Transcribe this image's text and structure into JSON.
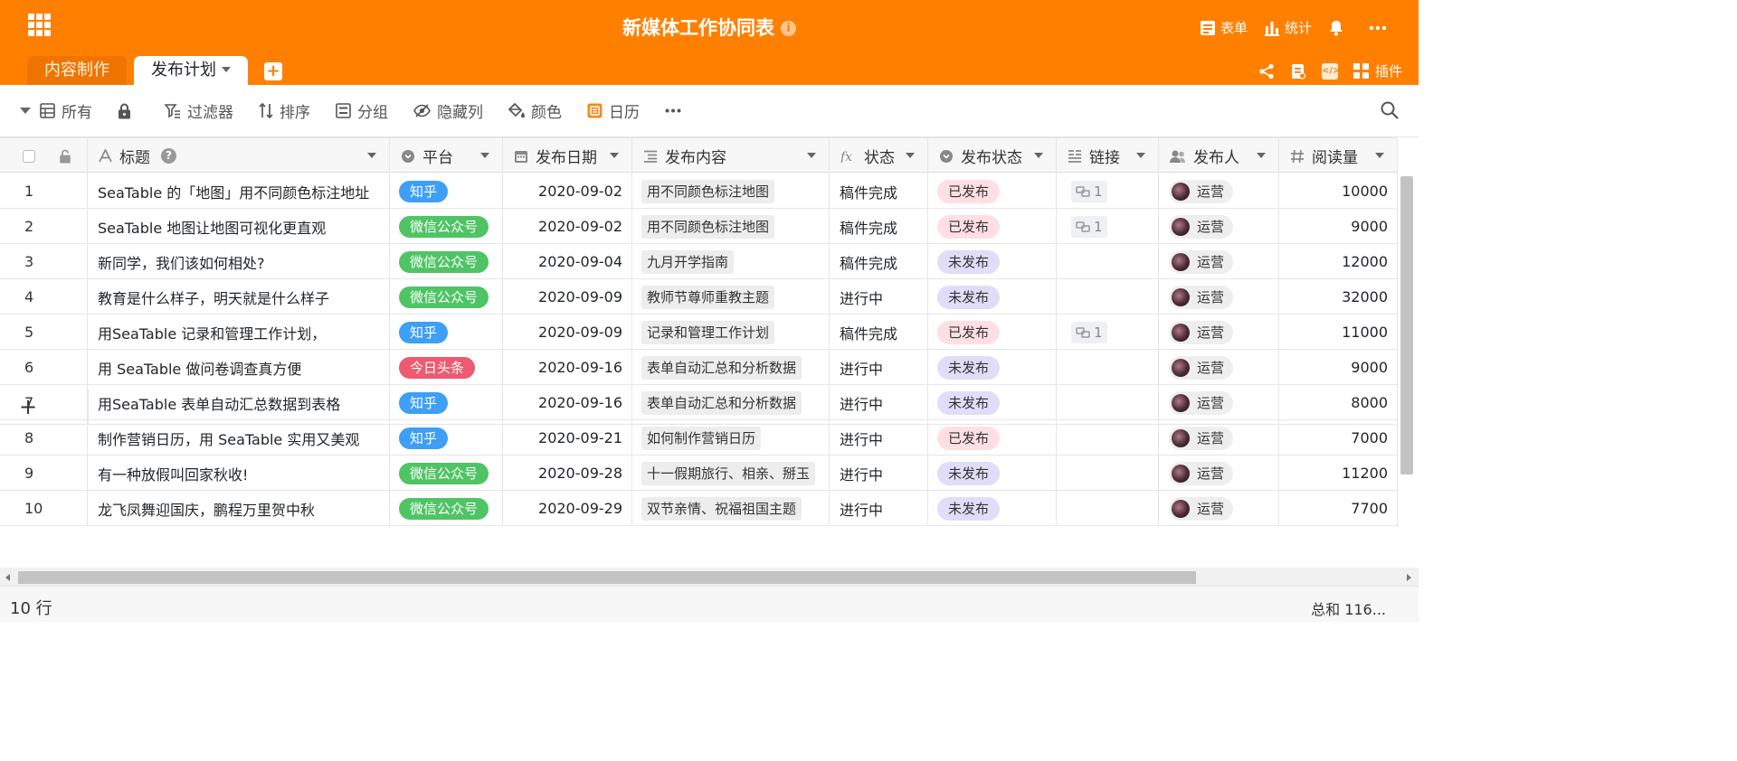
{
  "app": {
    "title": "新媒体工作协同表",
    "header_buttons": [
      {
        "label": "表单",
        "icon": "form-icon"
      },
      {
        "label": "统计",
        "icon": "bar-chart-icon"
      }
    ],
    "plugins_label": "插件"
  },
  "tabs": [
    {
      "label": "内容制作",
      "active": false
    },
    {
      "label": "发布计划",
      "active": true
    }
  ],
  "toolbar": {
    "view": "所有",
    "filter": "过滤器",
    "sort": "排序",
    "group": "分组",
    "hide": "隐藏列",
    "color": "颜色",
    "calendar": "日历"
  },
  "columns": {
    "title": "标题",
    "platform": "平台",
    "date": "发布日期",
    "content": "发布内容",
    "status": "状态",
    "pub_status": "发布状态",
    "link": "链接",
    "publisher": "发布人",
    "reads": "阅读量"
  },
  "colors": {
    "brand": "#ff8000",
    "知乎": "#3d9ff5",
    "微信公众号": "#4fc465",
    "今日头条": "#ee5a70",
    "已发布": "#ffdfe3",
    "未发布": "#e1dcf8"
  },
  "rows": [
    {
      "n": "1",
      "title": "SeaTable 的「地图」用不同颜色标注地址",
      "platform": "知乎",
      "date": "2020-09-02",
      "content": "用不同颜色标注地图",
      "status": "稿件完成",
      "pub": "已发布",
      "link": "1",
      "user": "运营",
      "reads": "10000"
    },
    {
      "n": "2",
      "title": "SeaTable 地图让地图可视化更直观",
      "platform": "微信公众号",
      "date": "2020-09-02",
      "content": "用不同颜色标注地图",
      "status": "稿件完成",
      "pub": "已发布",
      "link": "1",
      "user": "运营",
      "reads": "9000"
    },
    {
      "n": "3",
      "title": "新同学，我们该如何相处?",
      "platform": "微信公众号",
      "date": "2020-09-04",
      "content": "九月开学指南",
      "status": "稿件完成",
      "pub": "未发布",
      "link": "",
      "user": "运营",
      "reads": "12000"
    },
    {
      "n": "4",
      "title": "教育是什么样子，明天就是什么样子",
      "platform": "微信公众号",
      "date": "2020-09-09",
      "content": "教师节尊师重教主题",
      "status": "进行中",
      "pub": "未发布",
      "link": "",
      "user": "运营",
      "reads": "32000"
    },
    {
      "n": "5",
      "title": "用SeaTable 记录和管理工作计划，",
      "platform": "知乎",
      "date": "2020-09-09",
      "content": "记录和管理工作计划",
      "status": "稿件完成",
      "pub": "已发布",
      "link": "1",
      "user": "运营",
      "reads": "11000"
    },
    {
      "n": "6",
      "title": "用 SeaTable 做问卷调查真方便",
      "platform": "今日头条",
      "date": "2020-09-16",
      "content": "表单自动汇总和分析数据",
      "status": "进行中",
      "pub": "未发布",
      "link": "",
      "user": "运营",
      "reads": "9000"
    },
    {
      "n": "7",
      "title": "用SeaTable 表单自动汇总数据到表格",
      "platform": "知乎",
      "date": "2020-09-16",
      "content": "表单自动汇总和分析数据",
      "status": "进行中",
      "pub": "未发布",
      "link": "",
      "user": "运营",
      "reads": "8000"
    },
    {
      "n": "8",
      "title": "制作营销日历，用 SeaTable 实用又美观",
      "platform": "知乎",
      "date": "2020-09-21",
      "content": "如何制作营销日历",
      "status": "进行中",
      "pub": "已发布",
      "link": "",
      "user": "运营",
      "reads": "7000"
    },
    {
      "n": "9",
      "title": "有一种放假叫回家秋收!",
      "platform": "微信公众号",
      "date": "2020-09-28",
      "content": "十一假期旅行、相亲、掰玉",
      "status": "进行中",
      "pub": "未发布",
      "link": "",
      "user": "运营",
      "reads": "11200"
    },
    {
      "n": "10",
      "title": "龙飞凤舞迎国庆，鹏程万里贺中秋",
      "platform": "微信公众号",
      "date": "2020-09-29",
      "content": "双节亲情、祝福祖国主题",
      "status": "进行中",
      "pub": "未发布",
      "link": "",
      "user": "运营",
      "reads": "7700"
    }
  ],
  "footer": {
    "row_count": "10 行",
    "sum": "总和 116..."
  }
}
